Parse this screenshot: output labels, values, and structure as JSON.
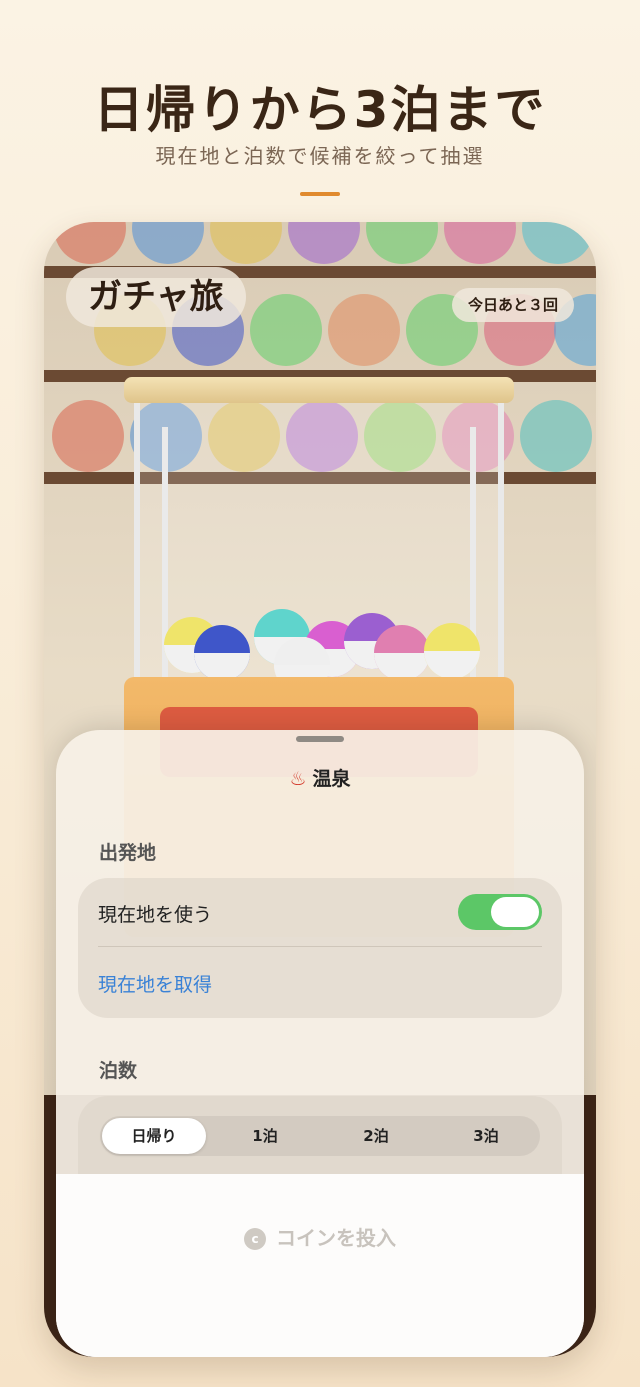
{
  "promo": {
    "headline": "日帰りから3泊まで",
    "subheadline": "現在地と泊数で候補を絞って抽選"
  },
  "app": {
    "title": "ガチャ旅",
    "remaining_badge": "今日あと３回",
    "accent_color": "#e08a2e"
  },
  "sheet": {
    "category_icon": "hot-spring-icon",
    "category_icon_glyph": "♨",
    "category_label": "温泉",
    "departure": {
      "section_label": "出発地",
      "use_location_label": "現在地を使う",
      "use_location_enabled": true,
      "get_location_link": "現在地を取得"
    },
    "nights": {
      "section_label": "泊数",
      "options": [
        "日帰り",
        "1泊",
        "2泊",
        "3泊"
      ],
      "selected": "日帰り"
    },
    "insert_coin_button": "コインを投入",
    "coin_icon_glyph": "c"
  },
  "colors": {
    "toggle_on": "#5cc767",
    "link": "#3a82d6",
    "floor": "#3d2517"
  }
}
